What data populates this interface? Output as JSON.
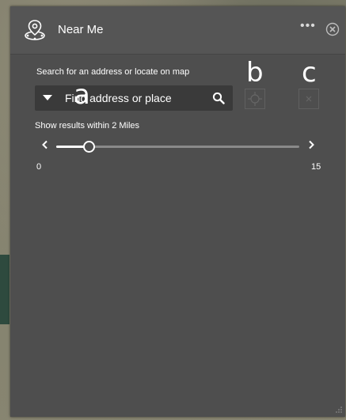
{
  "header": {
    "title": "Near Me",
    "more_label": "•••",
    "logo_icon": "location-pin-icon",
    "close_icon": "close-circle-icon"
  },
  "search": {
    "label": "Search for an address or locate on map",
    "placeholder": "Find address or place"
  },
  "buttons": {
    "locate_icon": "locate-crosshair-icon",
    "clear_icon": "clear-icon"
  },
  "annotations": {
    "a": "a",
    "b": "b",
    "c": "c"
  },
  "distance": {
    "label": "Show results within 2 Miles",
    "min": "0",
    "max": "15",
    "value": 2,
    "min_value": 0,
    "max_value": 15
  },
  "colors": {
    "panel": "#4e4e4e",
    "header": "#555555",
    "input": "#3a3a3a",
    "text": "#ffffff"
  }
}
